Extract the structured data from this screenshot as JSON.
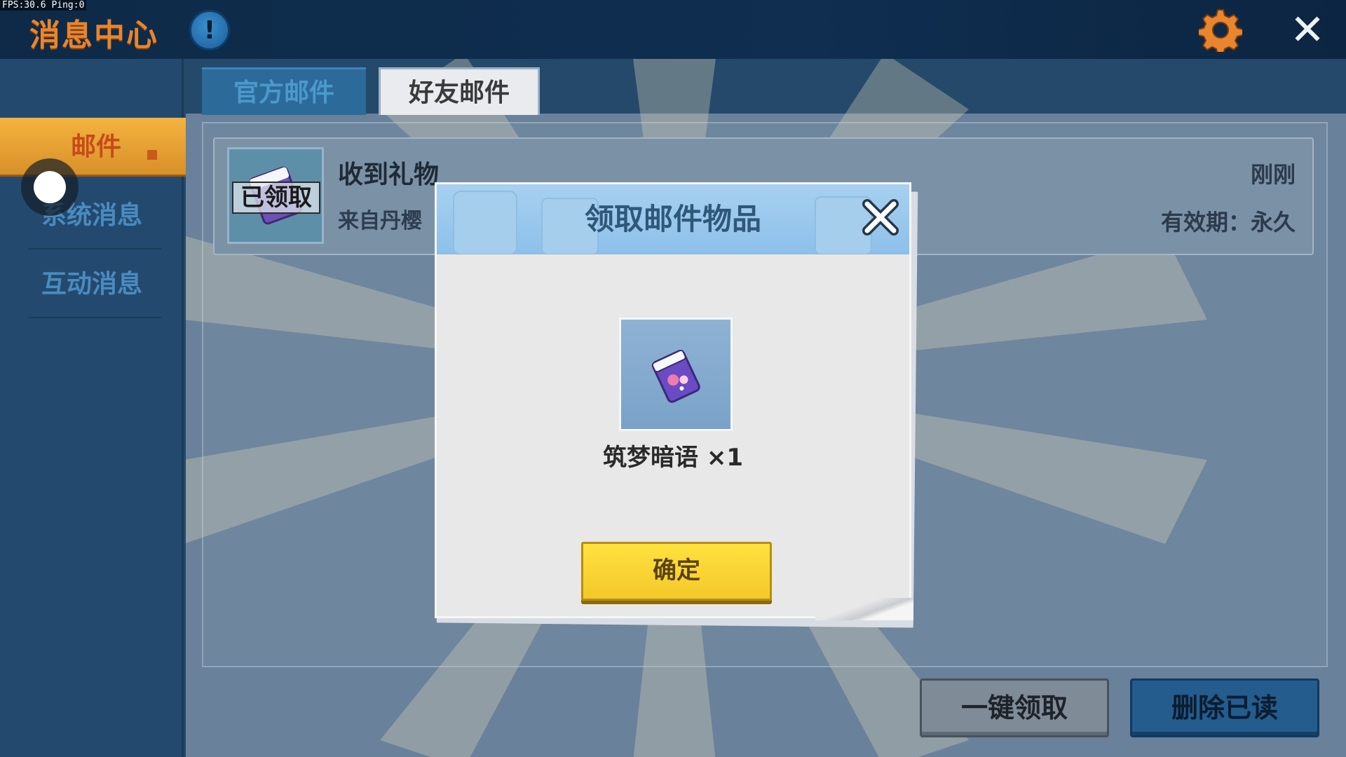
{
  "debug": {
    "fps_label": "FPS:30.6  Ping:0"
  },
  "header": {
    "title": "消息中心",
    "info_icon": "!"
  },
  "sidebar": {
    "items": [
      {
        "label": "邮件",
        "active": true
      },
      {
        "label": "系统消息",
        "active": false
      },
      {
        "label": "互动消息",
        "active": false
      }
    ]
  },
  "tabs": [
    {
      "label": "官方邮件",
      "active": false
    },
    {
      "label": "好友邮件",
      "active": true
    }
  ],
  "mail": {
    "title": "收到礼物",
    "from": "来自丹樱",
    "time": "刚刚",
    "expire": "有效期：永久",
    "stamp": "已领取"
  },
  "footer": {
    "claim_all_label": "一键领取",
    "delete_read_label": "删除已读"
  },
  "modal": {
    "title": "领取邮件物品",
    "item_name": "筑梦暗语 ×1",
    "confirm_label": "确定"
  },
  "colors": {
    "accent_orange": "#e8852e",
    "confirm_yellow": "#f4c82a",
    "header_blue": "#8dc0ea",
    "topbar_navy": "#0e2a48"
  }
}
